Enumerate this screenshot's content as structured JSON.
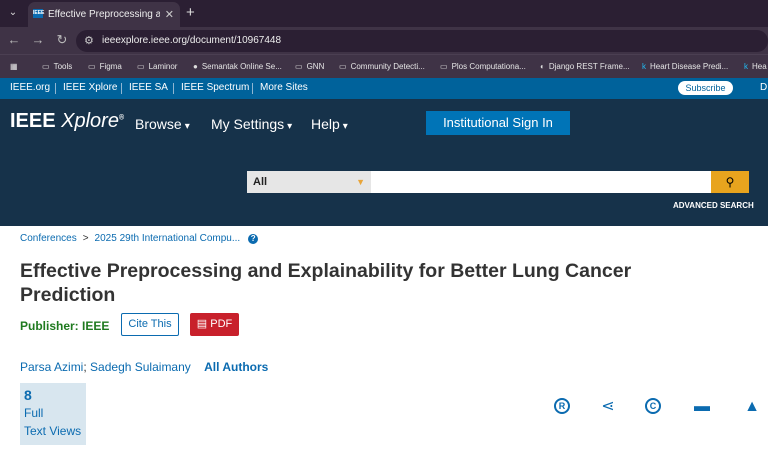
{
  "browser": {
    "tab_title": "Effective Preprocessing and Exp",
    "tab_favicon": "IEEE",
    "new_tab": "+",
    "close": "✕",
    "url": "ieeexplore.ieee.org/document/10967448",
    "bookmarks": [
      {
        "label": "Tools"
      },
      {
        "label": "Figma"
      },
      {
        "label": "Laminor"
      },
      {
        "label": "Semantak Online Se..."
      },
      {
        "label": "GNN"
      },
      {
        "label": "Community Detecti..."
      },
      {
        "label": "Plos Computationa..."
      },
      {
        "label": "Django REST Frame..."
      },
      {
        "label": "Heart Disease Predi..."
      },
      {
        "label": "Hea"
      }
    ]
  },
  "ieee_top": {
    "links": [
      "IEEE.org",
      "IEEE Xplore",
      "IEEE SA",
      "IEEE Spectrum",
      "More Sites"
    ],
    "subscribe": "Subscribe",
    "cut": "D"
  },
  "header": {
    "logo_main": "IEEE",
    "logo_italic": "Xplore",
    "logo_reg": "®",
    "menu": [
      "Browse",
      "My Settings",
      "Help"
    ],
    "institutional_sign_in": "Institutional Sign In",
    "search_select": "All",
    "advanced_search": "ADVANCED SEARCH"
  },
  "article": {
    "breadcrumb": [
      "Conferences",
      "2025 29th International Compu..."
    ],
    "breadcrumb_sep": ">",
    "title": "Effective Preprocessing and Explainability for Better Lung Cancer Prediction",
    "publisher_label": "Publisher:",
    "publisher": "IEEE",
    "cite": "Cite This",
    "pdf": "PDF",
    "authors": [
      "Parsa Azimi",
      "Sadegh Sulaimany"
    ],
    "author_sep": ";",
    "all_authors": "All Authors",
    "metric_value": "8",
    "metric_label1": "Full",
    "metric_label2": "Text Views"
  }
}
